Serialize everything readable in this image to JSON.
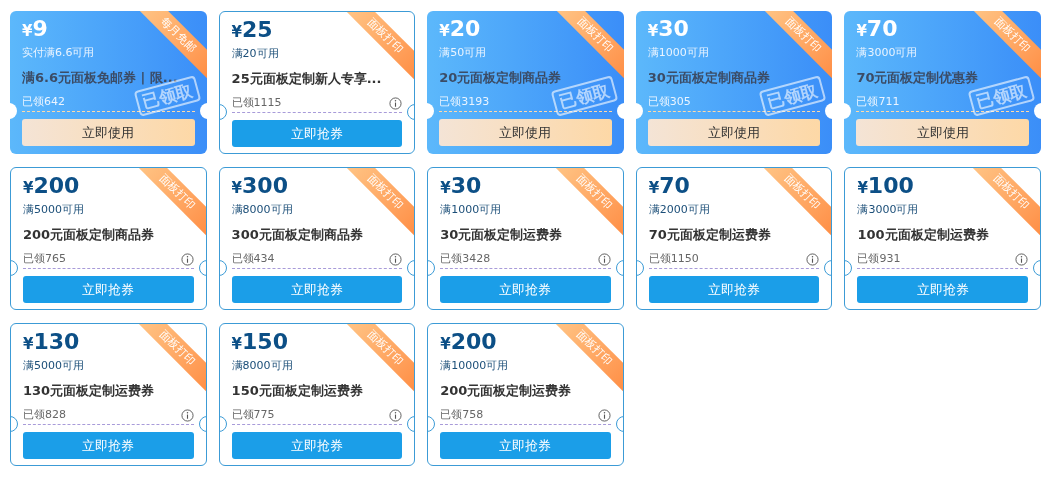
{
  "coupons": [
    {
      "claimed": true,
      "currency": "¥",
      "amount": "9",
      "condition": "实付满6.6可用",
      "title": "满6.6元面板免邮券 | 限...",
      "count": "已领642",
      "ribbon": "每月免邮",
      "stamp": "已领取",
      "button": "立即使用"
    },
    {
      "claimed": false,
      "currency": "¥",
      "amount": "25",
      "condition": "满20可用",
      "title": "25元面板定制新人专享...",
      "count": "已领1115",
      "ribbon": "面板打印",
      "button": "立即抢券"
    },
    {
      "claimed": true,
      "currency": "¥",
      "amount": "20",
      "condition": "满50可用",
      "title": "20元面板定制商品券",
      "count": "已领3193",
      "ribbon": "面板打印",
      "stamp": "已领取",
      "button": "立即使用"
    },
    {
      "claimed": true,
      "currency": "¥",
      "amount": "30",
      "condition": "满1000可用",
      "title": "30元面板定制商品券",
      "count": "已领305",
      "ribbon": "面板打印",
      "stamp": "已领取",
      "button": "立即使用"
    },
    {
      "claimed": true,
      "currency": "¥",
      "amount": "70",
      "condition": "满3000可用",
      "title": "70元面板定制优惠券",
      "count": "已领711",
      "ribbon": "面板打印",
      "stamp": "已领取",
      "button": "立即使用"
    },
    {
      "claimed": false,
      "currency": "¥",
      "amount": "200",
      "condition": "满5000可用",
      "title": "200元面板定制商品券",
      "count": "已领765",
      "ribbon": "面板打印",
      "button": "立即抢券"
    },
    {
      "claimed": false,
      "currency": "¥",
      "amount": "300",
      "condition": "满8000可用",
      "title": "300元面板定制商品券",
      "count": "已领434",
      "ribbon": "面板打印",
      "button": "立即抢券"
    },
    {
      "claimed": false,
      "currency": "¥",
      "amount": "30",
      "condition": "满1000可用",
      "title": "30元面板定制运费券",
      "count": "已领3428",
      "ribbon": "面板打印",
      "button": "立即抢券"
    },
    {
      "claimed": false,
      "currency": "¥",
      "amount": "70",
      "condition": "满2000可用",
      "title": "70元面板定制运费券",
      "count": "已领1150",
      "ribbon": "面板打印",
      "button": "立即抢券"
    },
    {
      "claimed": false,
      "currency": "¥",
      "amount": "100",
      "condition": "满3000可用",
      "title": "100元面板定制运费券",
      "count": "已领931",
      "ribbon": "面板打印",
      "button": "立即抢券"
    },
    {
      "claimed": false,
      "currency": "¥",
      "amount": "130",
      "condition": "满5000可用",
      "title": "130元面板定制运费券",
      "count": "已领828",
      "ribbon": "面板打印",
      "button": "立即抢券"
    },
    {
      "claimed": false,
      "currency": "¥",
      "amount": "150",
      "condition": "满8000可用",
      "title": "150元面板定制运费券",
      "count": "已领775",
      "ribbon": "面板打印",
      "button": "立即抢券"
    },
    {
      "claimed": false,
      "currency": "¥",
      "amount": "200",
      "condition": "满10000可用",
      "title": "200元面板定制运费券",
      "count": "已领758",
      "ribbon": "面板打印",
      "button": "立即抢券"
    }
  ]
}
